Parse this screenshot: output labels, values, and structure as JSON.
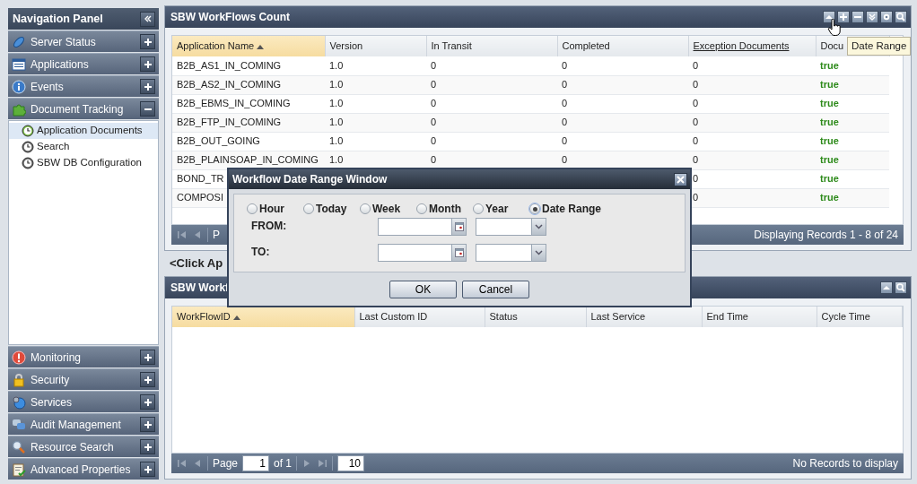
{
  "nav_panel": {
    "title": "Navigation Panel",
    "sections": [
      {
        "label": "Server Status",
        "expanded": false
      },
      {
        "label": "Applications",
        "expanded": false
      },
      {
        "label": "Events",
        "expanded": false
      },
      {
        "label": "Document Tracking",
        "expanded": true,
        "children": [
          {
            "label": "Application Documents",
            "selected": true
          },
          {
            "label": "Search",
            "selected": false
          },
          {
            "label": "SBW DB Configuration",
            "selected": false
          }
        ]
      },
      {
        "label": "Monitoring",
        "expanded": false
      },
      {
        "label": "Security",
        "expanded": false
      },
      {
        "label": "Services",
        "expanded": false
      },
      {
        "label": "Audit Management",
        "expanded": false
      },
      {
        "label": "Resource Search",
        "expanded": false
      },
      {
        "label": "Advanced Properties",
        "expanded": false
      }
    ]
  },
  "count_panel": {
    "title": "SBW WorkFlows Count",
    "tooltip": "Date Range",
    "columns": [
      {
        "label": "Application Name",
        "sorted": true,
        "link": false
      },
      {
        "label": "Version",
        "sorted": false,
        "link": false
      },
      {
        "label": "In Transit",
        "sorted": false,
        "link": false
      },
      {
        "label": "Completed",
        "sorted": false,
        "link": false
      },
      {
        "label": "Exception Documents",
        "sorted": false,
        "link": true
      },
      {
        "label": "Docu",
        "sorted": false,
        "link": false
      }
    ],
    "rows": [
      [
        "B2B_AS1_IN_COMING",
        "1.0",
        "0",
        "0",
        "0",
        "true"
      ],
      [
        "B2B_AS2_IN_COMING",
        "1.0",
        "0",
        "0",
        "0",
        "true"
      ],
      [
        "B2B_EBMS_IN_COMING",
        "1.0",
        "0",
        "0",
        "0",
        "true"
      ],
      [
        "B2B_FTP_IN_COMING",
        "1.0",
        "0",
        "0",
        "0",
        "true"
      ],
      [
        "B2B_OUT_GOING",
        "1.0",
        "0",
        "0",
        "0",
        "true"
      ],
      [
        "B2B_PLAINSOAP_IN_COMING",
        "1.0",
        "0",
        "0",
        "0",
        "true"
      ],
      [
        "BOND_TR",
        null,
        null,
        null,
        "0",
        "true"
      ],
      [
        "COMPOSI",
        null,
        null,
        null,
        "0",
        "true"
      ]
    ],
    "pager": {
      "page_label": "P",
      "status": "Displaying Records 1 - 8 of 24"
    }
  },
  "hint": "<Click Ap",
  "workflows_panel": {
    "title": "SBW Workf",
    "columns": [
      {
        "label": "WorkFlowID",
        "sorted": true
      },
      {
        "label": "Last Custom ID",
        "sorted": false
      },
      {
        "label": "Status",
        "sorted": false
      },
      {
        "label": "Last Service",
        "sorted": false
      },
      {
        "label": "End Time",
        "sorted": false
      },
      {
        "label": "Cycle Time",
        "sorted": false
      }
    ],
    "pager": {
      "page_label": "Page",
      "page": "1",
      "of": "of 1",
      "page_size": "10",
      "status": "No Records to display"
    }
  },
  "dialog": {
    "title": "Workflow Date Range Window",
    "options": [
      {
        "label": "Hour",
        "selected": false
      },
      {
        "label": "Today",
        "selected": false
      },
      {
        "label": "Week",
        "selected": false
      },
      {
        "label": "Month",
        "selected": false
      },
      {
        "label": "Year",
        "selected": false
      },
      {
        "label": "Date Range",
        "selected": true
      }
    ],
    "fields": [
      {
        "label": "FROM:"
      },
      {
        "label": "TO:"
      }
    ],
    "buttons": [
      "OK",
      "Cancel"
    ]
  }
}
